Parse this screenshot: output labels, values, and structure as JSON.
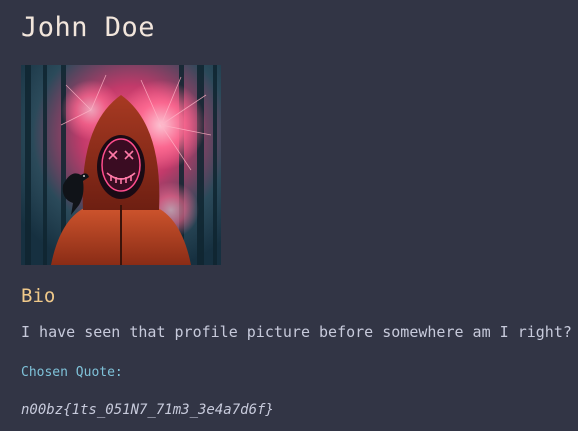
{
  "profile": {
    "name": "John Doe",
    "avatar_icon": "profile-picture-masked-hooded-figure"
  },
  "bio": {
    "heading": "Bio",
    "text": "I have seen that profile picture before somewhere am I right?"
  },
  "quote": {
    "label": "Chosen Quote:",
    "text": "n00bz{1ts_051N7_71m3_3e4a7d6f}"
  },
  "colors": {
    "background": "#323545",
    "name": "#f2e6dc",
    "heading": "#f0c98a",
    "label": "#7fc2d9",
    "text": "#c7cadb"
  }
}
